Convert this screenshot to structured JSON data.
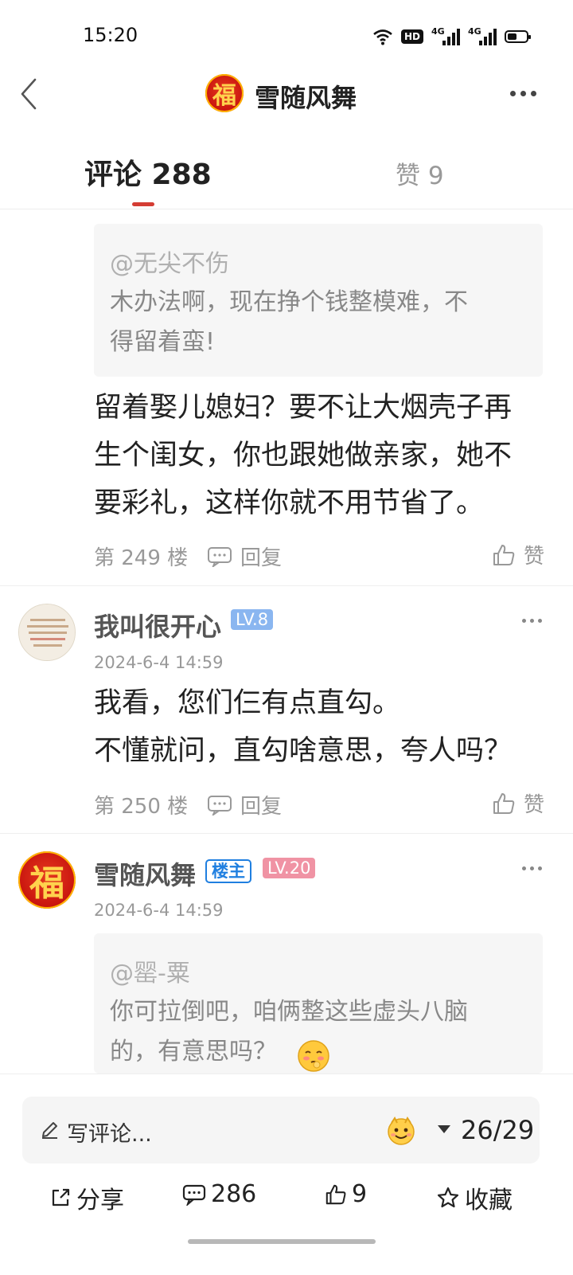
{
  "status_bar": {
    "time": "15:20",
    "hd_label": "HD",
    "network_label": "4G"
  },
  "header": {
    "avatar_char": "福",
    "title": "雪随风舞"
  },
  "tabs": {
    "comments": "评论 288",
    "likes": "赞 9"
  },
  "comment_249": {
    "quote_user": "@无尖不伤",
    "quote_line1": "木办法啊，现在挣个钱整模难，不",
    "quote_line2": "得留着蛮!",
    "line1": "留着娶儿媳妇？要不让大烟壳子再",
    "line2": "生个闺女，你也跟她做亲家，她不",
    "line3": "要彩礼，这样你就不用节省了。",
    "floor": "第 249 楼",
    "reply_label": "回复",
    "like_label": "赞"
  },
  "comment_250": {
    "username": "我叫很开心",
    "level": "LV.8",
    "time": "2024-6-4 14:59",
    "line1": "我看，您们仨有点直勾。",
    "line2": "不懂就问，直勾啥意思，夸人吗？",
    "floor": "第 250 楼",
    "reply_label": "回复",
    "like_label": "赞"
  },
  "comment_251": {
    "avatar_char": "福",
    "username": "雪随风舞",
    "owner_label": "楼主",
    "level": "LV.20",
    "time": "2024-6-4 14:59",
    "quote_user": "@罂-粟",
    "quote_line1": "你可拉倒吧，咱俩整这些虚头八脑",
    "quote_line2": "的，有意思吗？"
  },
  "bottom_bar": {
    "input_placeholder": "写评论...",
    "page_indicator": "26/29",
    "share": "分享",
    "comments": "286",
    "likes": "9",
    "collect": "收藏"
  },
  "colors": {
    "accent_red": "#d43c33",
    "level_blue": "#8ab6f0",
    "level_pink": "#f093a4",
    "owner_blue": "#1f7fe0"
  }
}
